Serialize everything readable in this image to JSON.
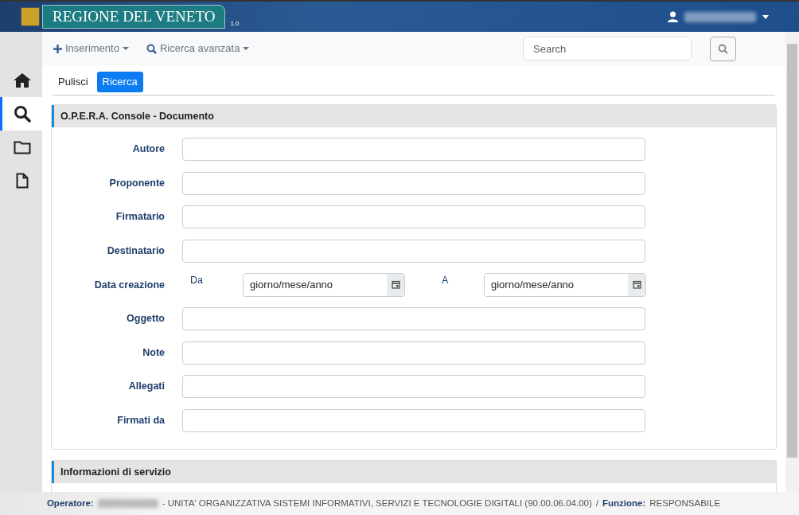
{
  "header": {
    "logo_text": "REGIONE DEL VENETO",
    "version": "1.0"
  },
  "sidebar": {
    "items": [
      {
        "kind": "home",
        "selected": false
      },
      {
        "kind": "search",
        "selected": true
      },
      {
        "kind": "folder",
        "selected": false
      },
      {
        "kind": "file",
        "selected": false
      }
    ]
  },
  "toolbar": {
    "menus": [
      {
        "kind": "plus",
        "label": "Inserimento"
      },
      {
        "kind": "search",
        "label": "Ricerca avanzata"
      }
    ],
    "search": {
      "placeholder": "Search"
    }
  },
  "actions": [
    {
      "label": "Pulisci",
      "selected": false
    },
    {
      "label": "Ricerca",
      "selected": true
    }
  ],
  "form": {
    "title": "O.P.E.R.A. Console - Documento",
    "fields": [
      {
        "kind": "text",
        "label": "Autore"
      },
      {
        "kind": "text",
        "label": "Proponente"
      },
      {
        "kind": "text",
        "label": "Firmatario"
      },
      {
        "kind": "text",
        "label": "Destinatario"
      },
      {
        "kind": "daterange",
        "label": "Data creazione",
        "from_label": "Da",
        "from_placeholder": "giorno/mese/anno",
        "to_label": "A",
        "to_placeholder": "giorno/mese/anno"
      },
      {
        "kind": "text",
        "label": "Oggetto"
      },
      {
        "kind": "text",
        "label": "Note"
      },
      {
        "kind": "text",
        "label": "Allegati"
      },
      {
        "kind": "text",
        "label": "Firmati da"
      }
    ]
  },
  "service_panel": {
    "title": "Informazioni di servizio"
  },
  "status_bar": {
    "operator_label": "Operatore:",
    "unit": "- UNITA' ORGANIZZATIVA SISTEMI INFORMATIVI, SERVIZI E TECNOLOGIE DIGITALI (90.00.06.04.00)",
    "separator": "/",
    "role_label": "Funzione:",
    "role": "RESPONSABILE"
  }
}
